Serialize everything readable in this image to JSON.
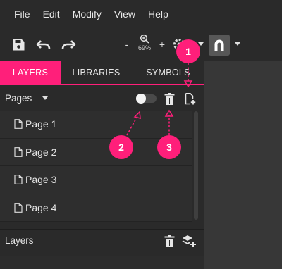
{
  "menu": [
    "File",
    "Edit",
    "Modify",
    "View",
    "Help"
  ],
  "toolbar": {
    "zoom_minus": "-",
    "zoom_plus": "+",
    "zoom_level": "69%"
  },
  "tabs": [
    {
      "label": "LAYERS",
      "active": true
    },
    {
      "label": "LIBRARIES",
      "active": false
    },
    {
      "label": "SYMBOLS",
      "active": false
    }
  ],
  "pages": {
    "title": "Pages",
    "items": [
      "Page 1",
      "Page 2",
      "Page 3",
      "Page 4"
    ]
  },
  "layers": {
    "title": "Layers"
  },
  "callouts": [
    "1",
    "2",
    "3"
  ],
  "colors": {
    "accent": "#ff1f7a",
    "panel": "#2a2a2a",
    "canvas": "#373737"
  },
  "icons": [
    "save-icon",
    "undo-icon",
    "redo-icon",
    "zoom-icon",
    "settings-icon",
    "magnet-icon",
    "chevron-down-icon",
    "toggle-switch",
    "trash-icon",
    "add-page-icon",
    "page-icon",
    "add-layer-icon"
  ]
}
